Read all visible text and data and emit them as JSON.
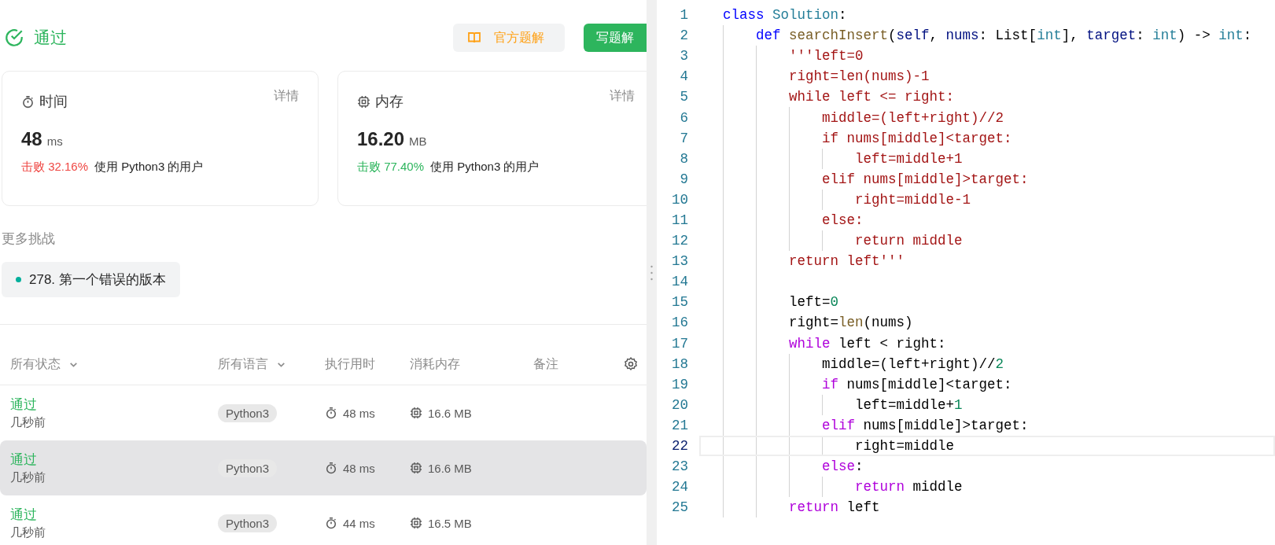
{
  "header": {
    "status": "通过",
    "buttons": [
      {
        "label": "官方题解",
        "kind": "secondary"
      },
      {
        "label": "写题解",
        "kind": "primary"
      }
    ]
  },
  "stats": [
    {
      "kind": "time",
      "title": "时间",
      "link": "详情",
      "value": "48",
      "unit": "ms",
      "beat": "击败 32.16%",
      "color": "#ef4743",
      "note": "使用 Python3 的用户"
    },
    {
      "kind": "memory",
      "title": "内存",
      "link": "详情",
      "value": "16.20",
      "unit": "MB",
      "beat": "击败 77.40%",
      "color": "#2db55d",
      "note": "使用 Python3 的用户"
    }
  ],
  "more": {
    "title": "更多挑战",
    "items": [
      {
        "label": "278. 第一个错误的版本",
        "color": "#00af9b"
      }
    ]
  },
  "table": {
    "columns": [
      {
        "label": "所有状态",
        "dropdown": true
      },
      {
        "label": "所有语言",
        "dropdown": true
      },
      {
        "label": "执行用时",
        "dropdown": false
      },
      {
        "label": "消耗内存",
        "dropdown": false
      },
      {
        "label": "备注",
        "dropdown": false
      }
    ],
    "rows": [
      {
        "status": "通过",
        "time_ago": "几秒前",
        "language": "Python3",
        "runtime": "48 ms",
        "memory": "16.6 MB",
        "selected": false
      },
      {
        "status": "通过",
        "time_ago": "几秒前",
        "language": "Python3",
        "runtime": "48 ms",
        "memory": "16.6 MB",
        "selected": true
      },
      {
        "status": "通过",
        "time_ago": "几秒前",
        "language": "Python3",
        "runtime": "44 ms",
        "memory": "16.5 MB",
        "selected": false
      }
    ]
  },
  "editor": {
    "lines": [
      {
        "number": "1",
        "current": false,
        "tokens": [
          {
            "t": "class ",
            "color": "#0000ff"
          },
          {
            "t": "Solution",
            "color": "#267f99"
          },
          {
            "t": ":",
            "color": "#000000"
          }
        ],
        "children": [
          {
            "number": "2",
            "current": false,
            "tokens": [
              {
                "t": "def ",
                "color": "#0000ff"
              },
              {
                "t": "searchInsert",
                "color": "#795e26"
              },
              {
                "t": "(",
                "color": "#000000"
              },
              {
                "t": "self",
                "color": "#001080"
              },
              {
                "t": ", ",
                "color": "#000000"
              },
              {
                "t": "nums",
                "color": "#001080"
              },
              {
                "t": ": List[",
                "color": "#000000"
              },
              {
                "t": "int",
                "color": "#267f99"
              },
              {
                "t": "], ",
                "color": "#000000"
              },
              {
                "t": "target",
                "color": "#001080"
              },
              {
                "t": ": ",
                "color": "#000000"
              },
              {
                "t": "int",
                "color": "#267f99"
              },
              {
                "t": ") -> ",
                "color": "#000000"
              },
              {
                "t": "int",
                "color": "#267f99"
              },
              {
                "t": ":",
                "color": "#000000"
              }
            ],
            "children": [
              {
                "number": "3",
                "current": false,
                "tokens": [
                  {
                    "t": "'''left=0",
                    "color": "#a31515"
                  }
                ]
              },
              {
                "number": "4",
                "current": false,
                "tokens": [
                  {
                    "t": "right=len(nums)-1",
                    "color": "#a31515"
                  }
                ]
              },
              {
                "number": "5",
                "current": false,
                "tokens": [
                  {
                    "t": "while left <= right:",
                    "color": "#a31515"
                  }
                ],
                "children": [
                  {
                    "number": "6",
                    "current": false,
                    "tokens": [
                      {
                        "t": "middle=(left+right)//2",
                        "color": "#a31515"
                      }
                    ]
                  },
                  {
                    "number": "7",
                    "current": false,
                    "tokens": [
                      {
                        "t": "if nums[middle]<target:",
                        "color": "#a31515"
                      }
                    ],
                    "children": [
                      {
                        "number": "8",
                        "current": false,
                        "tokens": [
                          {
                            "t": "left=middle+1",
                            "color": "#a31515"
                          }
                        ]
                      }
                    ]
                  },
                  {
                    "number": "9",
                    "current": false,
                    "tokens": [
                      {
                        "t": "elif nums[middle]>target:",
                        "color": "#a31515"
                      }
                    ],
                    "children": [
                      {
                        "number": "10",
                        "current": false,
                        "tokens": [
                          {
                            "t": "right=middle-1",
                            "color": "#a31515"
                          }
                        ]
                      }
                    ]
                  },
                  {
                    "number": "11",
                    "current": false,
                    "tokens": [
                      {
                        "t": "else:",
                        "color": "#a31515"
                      }
                    ],
                    "children": [
                      {
                        "number": "12",
                        "current": false,
                        "tokens": [
                          {
                            "t": "return middle",
                            "color": "#a31515"
                          }
                        ]
                      }
                    ]
                  }
                ]
              },
              {
                "number": "13",
                "current": false,
                "tokens": [
                  {
                    "t": "return left'''",
                    "color": "#a31515"
                  }
                ]
              },
              {
                "number": "14",
                "current": false
              },
              {
                "number": "15",
                "current": false,
                "tokens": [
                  {
                    "t": "left=",
                    "color": "#000000"
                  },
                  {
                    "t": "0",
                    "color": "#098658"
                  }
                ]
              },
              {
                "number": "16",
                "current": false,
                "tokens": [
                  {
                    "t": "right=",
                    "color": "#000000"
                  },
                  {
                    "t": "len",
                    "color": "#795e26"
                  },
                  {
                    "t": "(nums)",
                    "color": "#000000"
                  }
                ]
              },
              {
                "number": "17",
                "current": false,
                "tokens": [
                  {
                    "t": "while ",
                    "color": "#af00db"
                  },
                  {
                    "t": "left < right:",
                    "color": "#000000"
                  }
                ],
                "children": [
                  {
                    "number": "18",
                    "current": false,
                    "tokens": [
                      {
                        "t": "middle=(left+right)//",
                        "color": "#000000"
                      },
                      {
                        "t": "2",
                        "color": "#098658"
                      }
                    ]
                  },
                  {
                    "number": "19",
                    "current": false,
                    "tokens": [
                      {
                        "t": "if ",
                        "color": "#af00db"
                      },
                      {
                        "t": "nums[middle]<target:",
                        "color": "#000000"
                      }
                    ],
                    "children": [
                      {
                        "number": "20",
                        "current": false,
                        "tokens": [
                          {
                            "t": "left=middle+",
                            "color": "#000000"
                          },
                          {
                            "t": "1",
                            "color": "#098658"
                          }
                        ]
                      }
                    ]
                  },
                  {
                    "number": "21",
                    "current": false,
                    "tokens": [
                      {
                        "t": "elif ",
                        "color": "#af00db"
                      },
                      {
                        "t": "nums[middle]>target:",
                        "color": "#000000"
                      }
                    ],
                    "children": [
                      {
                        "number": "22",
                        "current": true,
                        "tokens": [
                          {
                            "t": "right=middle",
                            "color": "#000000"
                          }
                        ]
                      }
                    ]
                  },
                  {
                    "number": "23",
                    "current": false,
                    "tokens": [
                      {
                        "t": "else",
                        "color": "#af00db"
                      },
                      {
                        "t": ":",
                        "color": "#000000"
                      }
                    ],
                    "children": [
                      {
                        "number": "24",
                        "current": false,
                        "tokens": [
                          {
                            "t": "return ",
                            "color": "#af00db"
                          },
                          {
                            "t": "middle",
                            "color": "#000000"
                          }
                        ]
                      }
                    ]
                  }
                ]
              },
              {
                "number": "25",
                "current": false,
                "tokens": [
                  {
                    "t": "return ",
                    "color": "#af00db"
                  },
                  {
                    "t": "left",
                    "color": "#000000"
                  }
                ]
              }
            ]
          }
        ]
      }
    ]
  }
}
